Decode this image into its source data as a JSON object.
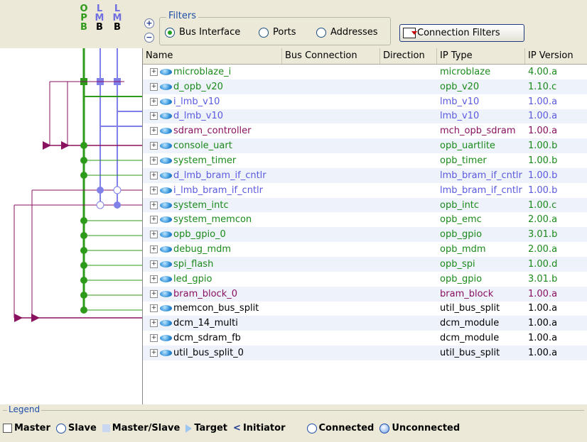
{
  "buses": [
    {
      "letters": [
        "O",
        "P",
        "B"
      ],
      "color": "#2e9a1a"
    },
    {
      "letters": [
        "L",
        "M",
        "B"
      ],
      "color": "#7070e0"
    },
    {
      "letters": [
        "L",
        "M",
        "B"
      ],
      "color": "#7070e0"
    }
  ],
  "filters": {
    "title": "Filters",
    "zoom_in": "+",
    "zoom_out": "−",
    "options": [
      {
        "label": "Bus Interface",
        "selected": true
      },
      {
        "label": "Ports",
        "selected": false
      },
      {
        "label": "Addresses",
        "selected": false
      }
    ],
    "connection_filters_label": "Connection Filters"
  },
  "table": {
    "columns": [
      "Name",
      "Bus Connection",
      "Direction",
      "IP Type",
      "IP Version"
    ],
    "rows": [
      {
        "name": "microblaze_i",
        "type": "microblaze",
        "version": "4.00.a",
        "color": "#1a8a1a"
      },
      {
        "name": "d_opb_v20",
        "type": "opb_v20",
        "version": "1.10.c",
        "color": "#1a8a1a"
      },
      {
        "name": "i_lmb_v10",
        "type": "lmb_v10",
        "version": "1.00.a",
        "color": "#5a5ae0"
      },
      {
        "name": "d_lmb_v10",
        "type": "lmb_v10",
        "version": "1.00.a",
        "color": "#5a5ae0"
      },
      {
        "name": "sdram_controller",
        "type": "mch_opb_sdram",
        "version": "1.00.a",
        "color": "#8a1060"
      },
      {
        "name": "console_uart",
        "type": "opb_uartlite",
        "version": "1.00.b",
        "color": "#1a8a1a"
      },
      {
        "name": "system_timer",
        "type": "opb_timer",
        "version": "1.00.b",
        "color": "#1a8a1a"
      },
      {
        "name": "d_lmb_bram_if_cntlr",
        "type": "lmb_bram_if_cntlr",
        "version": "1.00.b",
        "color": "#5a5ae0"
      },
      {
        "name": "i_lmb_bram_if_cntlr",
        "type": "lmb_bram_if_cntlr",
        "version": "1.00.b",
        "color": "#5a5ae0"
      },
      {
        "name": "system_intc",
        "type": "opb_intc",
        "version": "1.00.c",
        "color": "#1a8a1a"
      },
      {
        "name": "system_memcon",
        "type": "opb_emc",
        "version": "2.00.a",
        "color": "#1a8a1a"
      },
      {
        "name": "opb_gpio_0",
        "type": "opb_gpio",
        "version": "3.01.b",
        "color": "#1a8a1a"
      },
      {
        "name": "debug_mdm",
        "type": "opb_mdm",
        "version": "2.00.a",
        "color": "#1a8a1a"
      },
      {
        "name": "spi_flash",
        "type": "opb_spi",
        "version": "1.00.d",
        "color": "#1a8a1a"
      },
      {
        "name": "led_gpio",
        "type": "opb_gpio",
        "version": "3.01.b",
        "color": "#1a8a1a"
      },
      {
        "name": "bram_block_0",
        "type": "bram_block",
        "version": "1.00.a",
        "color": "#8a1060"
      },
      {
        "name": "memcon_bus_split",
        "type": "util_bus_split",
        "version": "1.00.a",
        "color": "#000000"
      },
      {
        "name": "dcm_14_multi",
        "type": "dcm_module",
        "version": "1.00.a",
        "color": "#000000"
      },
      {
        "name": "dcm_sdram_fb",
        "type": "dcm_module",
        "version": "1.00.a",
        "color": "#000000"
      },
      {
        "name": "util_bus_split_0",
        "type": "util_bus_split",
        "version": "1.00.a",
        "color": "#000000"
      }
    ]
  },
  "legend": {
    "title": "Legend",
    "items": {
      "master": "Master",
      "slave": "Slave",
      "master_slave": "Master/Slave",
      "target": "Target",
      "initiator": "Initiator",
      "connected": "Connected",
      "unconnected": "Unconnected"
    }
  }
}
